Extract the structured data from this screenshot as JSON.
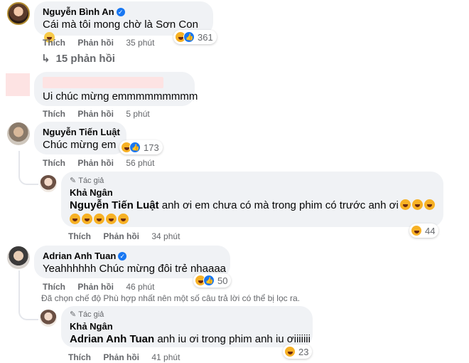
{
  "comments": [
    {
      "name": "Nguyễn Bình An",
      "text": "Cái mà tôi mong chờ là Sơn Con",
      "actions": {
        "like": "Thích",
        "reply": "Phản hồi",
        "time": "35 phút"
      },
      "reaction_count": "361",
      "replies_link": "15 phản hồi"
    },
    {
      "name": "",
      "text": "Ui chúc mừng emmmmmmmmm",
      "actions": {
        "like": "Thích",
        "reply": "Phản hồi",
        "time": "5 phút"
      }
    },
    {
      "name": "Nguyễn Tiến Luật",
      "text": "Chúc mừng em",
      "actions": {
        "like": "Thích",
        "reply": "Phản hồi",
        "time": "56 phút"
      },
      "reaction_count": "173",
      "reply": {
        "author_tag": "Tác giả",
        "name": "Khả Ngân",
        "mention": "Nguyễn Tiến Luật",
        "text": " anh ơi em chưa có mà trong phim có trước anh ơi",
        "actions": {
          "like": "Thích",
          "reply": "Phản hồi",
          "time": "34 phút"
        },
        "reaction_count": "44"
      }
    },
    {
      "name": "Adrian Anh Tuan",
      "text": "Yeahhhhhh Chúc mừng đôi trẻ nhaaaa",
      "actions": {
        "like": "Thích",
        "reply": "Phản hồi",
        "time": "46 phút"
      },
      "reaction_count": "50",
      "notice": "Đã chọn chế độ Phù hợp nhất nên một số câu trả lời có thể bị lọc ra.",
      "reply": {
        "author_tag": "Tác giả",
        "name": "Khả Ngân",
        "mention": "Adrian Anh Tuan",
        "text": " anh iu ơi trong phim anh iu ơiiiiiii",
        "actions": {
          "like": "Thích",
          "reply": "Phản hồi",
          "time": "41 phút"
        },
        "reaction_count": "23"
      }
    }
  ],
  "icons": {
    "verified": "✓",
    "replies_arrow": "↳",
    "pencil": "✎"
  },
  "colors": {
    "bubble": "#f0f2f5",
    "secondary_text": "#65676b",
    "verified_blue": "#1877f2",
    "haha_yellow": "#f7b125"
  }
}
